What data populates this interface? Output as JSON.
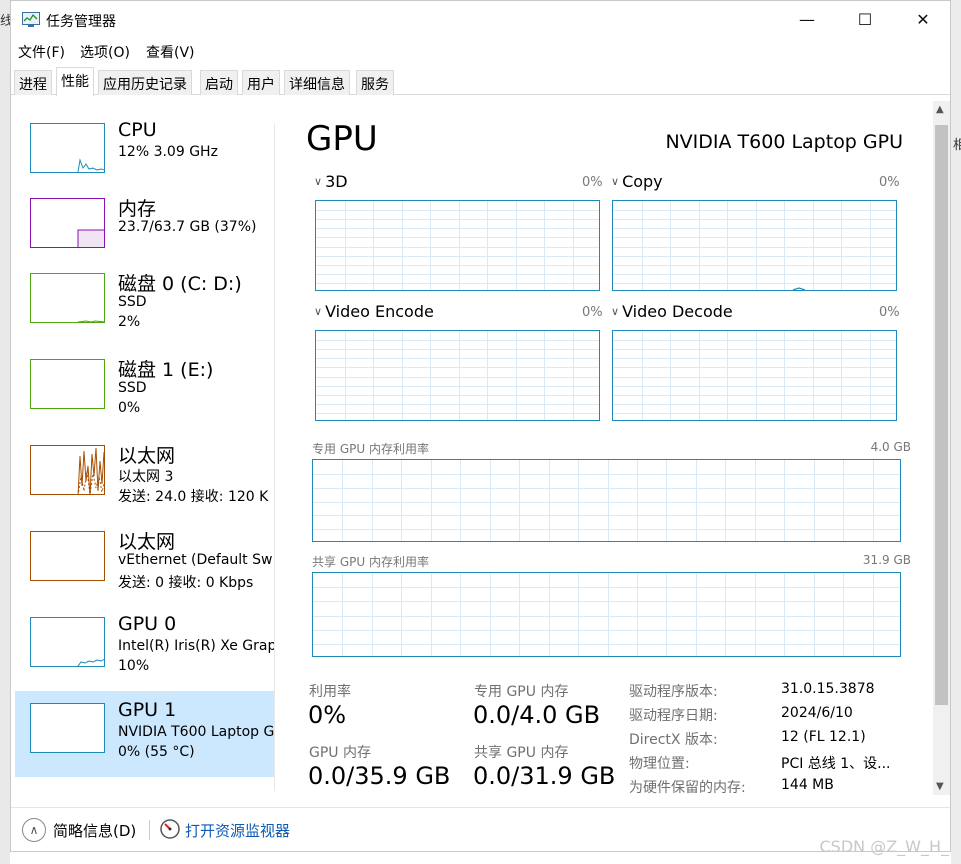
{
  "background": {
    "left_fragment": "线",
    "right_fragment": "相"
  },
  "window": {
    "title": "任务管理器",
    "controls": {
      "minimize": "—",
      "maximize": "☐",
      "close": "✕"
    }
  },
  "menu": [
    "文件(F)",
    "选项(O)",
    "查看(V)"
  ],
  "tabs": [
    "进程",
    "性能",
    "应用历史记录",
    "启动",
    "用户",
    "详细信息",
    "服务"
  ],
  "sidebar": {
    "items": [
      {
        "name": "CPU",
        "line1": "12% 3.09 GHz",
        "line2": ""
      },
      {
        "name": "内存",
        "line1": "23.7/63.7 GB (37%)",
        "line2": ""
      },
      {
        "name": "磁盘 0 (C: D:)",
        "line1": "SSD",
        "line2": "2%"
      },
      {
        "name": "磁盘 1 (E:)",
        "line1": "SSD",
        "line2": "0%"
      },
      {
        "name": "以太网",
        "line1": "以太网 3",
        "line2": "发送: 24.0 接收: 120 K"
      },
      {
        "name": "以太网",
        "line1": "vEthernet (Default Sw",
        "line2": "发送: 0 接收: 0 Kbps"
      },
      {
        "name": "GPU 0",
        "line1": "Intel(R) Iris(R) Xe Grap",
        "line2": "10%"
      },
      {
        "name": "GPU 1",
        "line1": "NVIDIA T600 Laptop G",
        "line2": "0% (55 °C)"
      }
    ]
  },
  "main": {
    "title": "GPU",
    "device": "NVIDIA T600 Laptop GPU",
    "engines": [
      {
        "label": "3D",
        "pct": "0%"
      },
      {
        "label": "Copy",
        "pct": "0%"
      },
      {
        "label": "Video Encode",
        "pct": "0%"
      },
      {
        "label": "Video Decode",
        "pct": "0%"
      }
    ],
    "dedicated_mem": {
      "label": "专用 GPU 内存利用率",
      "max": "4.0 GB"
    },
    "shared_mem": {
      "label": "共享 GPU 内存利用率",
      "max": "31.9 GB"
    },
    "stats": {
      "utilization_label": "利用率",
      "utilization_value": "0%",
      "dedicated_label": "专用 GPU 内存",
      "dedicated_value": "0.0/4.0 GB",
      "gpu_mem_label": "GPU 内存",
      "gpu_mem_value": "0.0/35.9 GB",
      "shared_label": "共享 GPU 内存",
      "shared_value": "0.0/31.9 GB"
    },
    "info": [
      {
        "key": "驱动程序版本:",
        "value": "31.0.15.3878"
      },
      {
        "key": "驱动程序日期:",
        "value": "2024/6/10"
      },
      {
        "key": "DirectX 版本:",
        "value": "12 (FL 12.1)"
      },
      {
        "key": "物理位置:",
        "value": "PCI 总线 1、设..."
      },
      {
        "key": "为硬件保留的内存:",
        "value": "144 MB"
      }
    ]
  },
  "footer": {
    "brief": "简略信息(D)",
    "resource_monitor": "打开资源监视器"
  },
  "watermark": "CSDN @Z_W_H_",
  "colors": {
    "cpu": "#1e8ab9",
    "memory": "#8b12ae",
    "disk": "#4da60c",
    "ethernet": "#a74f01",
    "gpu": "#1e8ab9",
    "selected": "#cce8ff"
  }
}
